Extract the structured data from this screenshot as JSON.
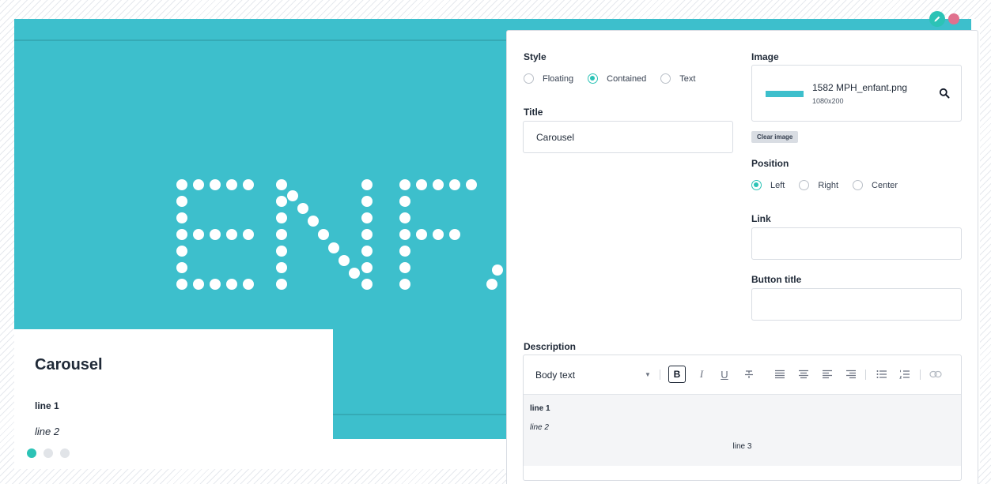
{
  "carousel": {
    "banner_text": "ENFANT",
    "caption_title": "Carousel",
    "caption_line1": "line 1",
    "caption_line2": "line 2",
    "slide_count": 3,
    "active_slide": 1
  },
  "panel": {
    "style_label": "Style",
    "style_options": [
      "Floating",
      "Contained",
      "Text"
    ],
    "style_selected": "Contained",
    "title_label": "Title",
    "title_value": "Carousel",
    "image_label": "Image",
    "image_name": "1582 MPH_enfant.png",
    "image_size": "1080x200",
    "clear_image_label": "Clear image",
    "position_label": "Position",
    "position_options": [
      "Left",
      "Right",
      "Center"
    ],
    "position_selected": "Left",
    "link_label": "Link",
    "link_value": "",
    "button_title_label": "Button title",
    "button_title_value": "",
    "description_label": "Description",
    "editor": {
      "format_value": "Body text",
      "content_line1": "line 1",
      "content_line2": "line 2",
      "content_line3": "line 3"
    }
  },
  "colors": {
    "accent": "#2cc3b6",
    "banner": "#3dbfcc",
    "delete": "#e0718e"
  }
}
